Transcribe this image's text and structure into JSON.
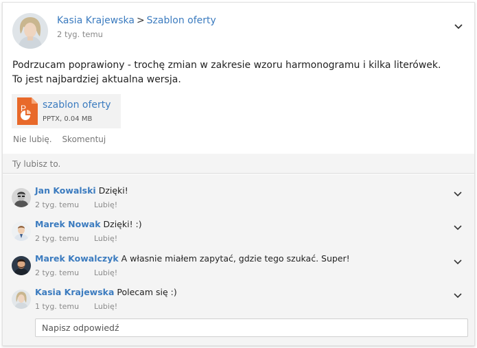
{
  "post": {
    "author": "Kasia Krajewska",
    "separator": ">",
    "target": "Szablon oferty",
    "time": "2 tyg. temu",
    "text": "Podrzucam poprawiony - trochę zmian w zakresie wzoru harmonogramu i kilka literówek. To jest najbardziej aktualna wersja.",
    "attachment": {
      "name": "szablon oferty",
      "meta": "PPTX, 0.04 MB",
      "icon": "pptx-file-icon",
      "color": "#e8692a"
    },
    "actions": {
      "unlike": "Nie lubię.",
      "comment": "Skomentuj"
    },
    "likes_text": "Ty lubisz to."
  },
  "comments": [
    {
      "author": "Jan Kowalski",
      "text": "Dzięki!",
      "time": "2 tyg. temu",
      "like": "Lubię!"
    },
    {
      "author": "Marek Nowak",
      "text": "Dzięki! :)",
      "time": "2 tyg. temu",
      "like": "Lubię!"
    },
    {
      "author": "Marek Kowalczyk",
      "text": "A własnie miałem zapytać, gdzie tego szukać. Super!",
      "time": "2 tyg. temu",
      "like": "Lubię!"
    },
    {
      "author": "Kasia Krajewska",
      "text": "Polecam się :)",
      "time": "1 tyg. temu",
      "like": "Lubię!"
    }
  ],
  "reply": {
    "placeholder": "Napisz odpowiedź"
  },
  "colors": {
    "link": "#3b7bbf",
    "muted": "#8a8a8a",
    "panel": "#f4f4f4"
  }
}
